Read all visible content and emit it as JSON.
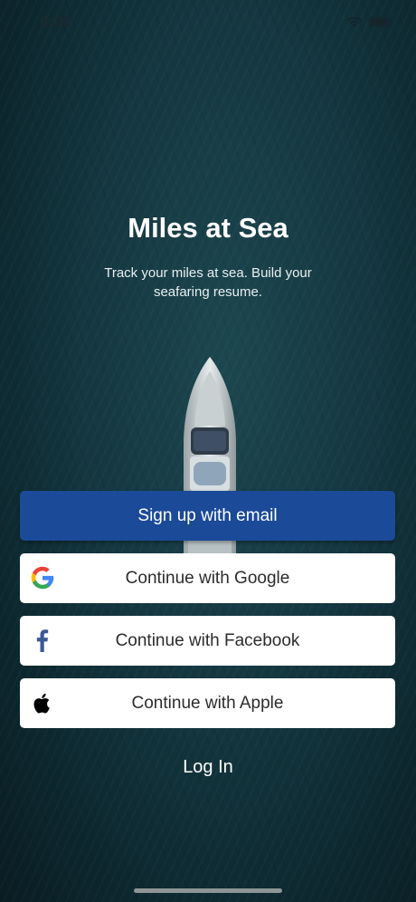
{
  "status_bar": {
    "time": "6:09",
    "icons": [
      "wifi-icon",
      "battery-icon"
    ]
  },
  "header": {
    "title": "Miles at Sea",
    "subtitle": "Track your miles at sea. Build your seafaring resume."
  },
  "buttons": {
    "email": {
      "label": "Sign up with email",
      "color": "#1b4a98"
    },
    "google": {
      "label": "Continue with Google",
      "icon": "google-icon"
    },
    "facebook": {
      "label": "Continue with Facebook",
      "icon": "facebook-icon",
      "icon_color": "#3b5998"
    },
    "apple": {
      "label": "Continue with Apple",
      "icon": "apple-icon"
    }
  },
  "login": {
    "label": "Log In"
  },
  "colors": {
    "background": "#143740",
    "primary_button": "#1b4a98",
    "secondary_button": "#ffffff"
  }
}
